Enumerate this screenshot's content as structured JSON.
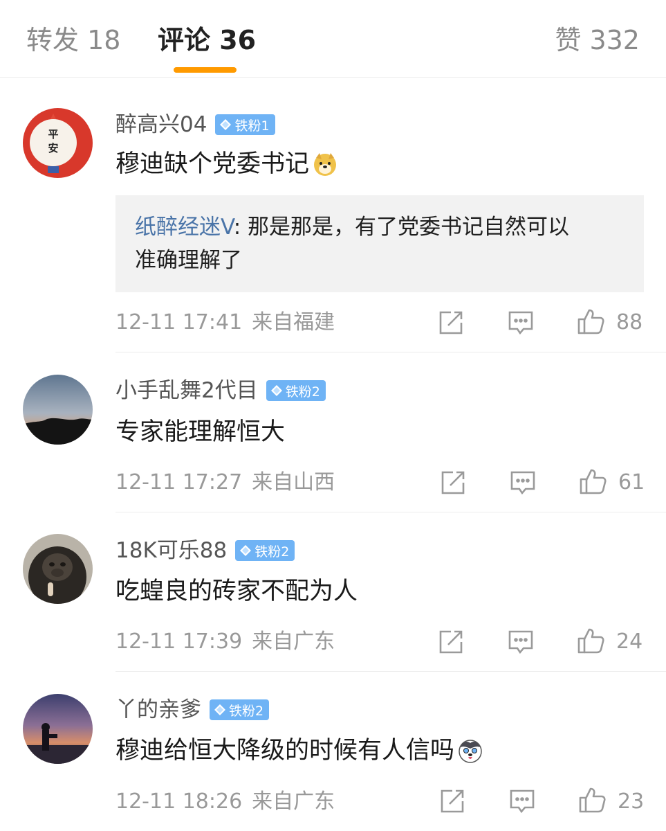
{
  "tabs": {
    "repost": "转发 18",
    "comments": "评论 36",
    "likes": "赞 332"
  },
  "colors": {
    "accent": "#ff9a00",
    "badge": "#6fb3f5",
    "reply_author": "#4a74a8",
    "meta": "#999999"
  },
  "icons": {
    "share": "share-icon",
    "reply": "comment-icon",
    "like": "thumbs-up-icon",
    "badge": "diamond-icon"
  },
  "comments": [
    {
      "username": "醉高兴04",
      "badge": "铁粉1",
      "text": "穆迪缺个党委书记",
      "emoji": "doge-emoji-icon",
      "avatar_text": "平安",
      "reply": {
        "author": "纸醉经迷V",
        "separator": ":",
        "text_line1": " 那是那是，有了党委书记自然可以",
        "text_line2": "准确理解了"
      },
      "time": "12-11 17:41",
      "location": "来自福建",
      "likes": "88"
    },
    {
      "username": "小手乱舞2代目",
      "badge": "铁粉2",
      "text": "专家能理解恒大",
      "time": "12-11 17:27",
      "location": "来自山西",
      "likes": "61"
    },
    {
      "username": "18K可乐88",
      "badge": "铁粉2",
      "text": "吃蝗良的砖家不配为人",
      "time": "12-11 17:39",
      "location": "来自广东",
      "likes": "24"
    },
    {
      "username": "丫的亲爹",
      "badge": "铁粉2",
      "text": "穆迪给恒大降级的时候有人信吗",
      "emoji": "husky-emoji-icon",
      "time": "12-11 18:26",
      "location": "来自广东",
      "likes": "23"
    }
  ]
}
